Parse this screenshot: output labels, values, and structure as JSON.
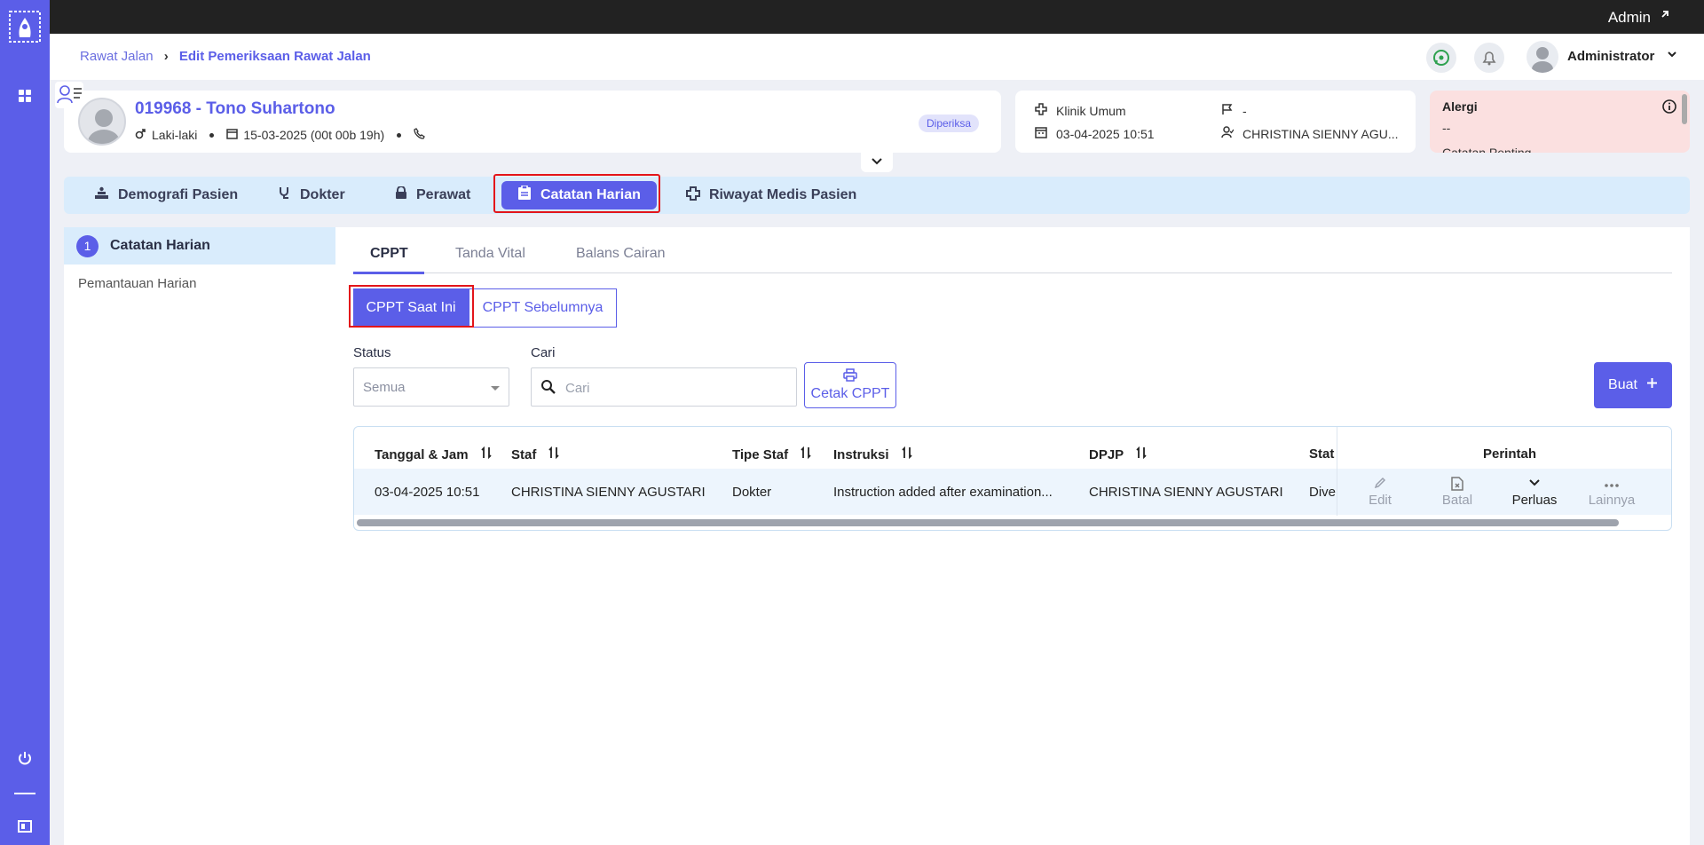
{
  "topbar": {
    "admin_label": "Admin"
  },
  "header": {
    "breadcrumb": {
      "parent": "Rawat Jalan",
      "current": "Edit Pemeriksaan Rawat Jalan"
    },
    "user_name": "Administrator"
  },
  "patient": {
    "name": "019968 - Tono Suhartono",
    "gender": "Laki-laki",
    "birth": "15-03-2025 (00t 00b 19h)",
    "status_badge": "Diperiksa"
  },
  "visit": {
    "clinic": "Klinik Umum",
    "datetime": "03-04-2025 10:51",
    "flag_value": "-",
    "doctor": "CHRISTINA SIENNY AGU..."
  },
  "allergy": {
    "title": "Alergi",
    "value": "--",
    "more": "Catatan Penting"
  },
  "main_tabs": [
    {
      "label": "Demografi Pasien"
    },
    {
      "label": "Dokter"
    },
    {
      "label": "Perawat"
    },
    {
      "label": "Catatan Harian"
    },
    {
      "label": "Riwayat Medis Pasien"
    }
  ],
  "steps": {
    "active_num": "1",
    "active_label": "Catatan Harian",
    "second": "Pemantauan Harian"
  },
  "sub_tabs": [
    {
      "label": "CPPT"
    },
    {
      "label": "Tanda Vital"
    },
    {
      "label": "Balans Cairan"
    }
  ],
  "toggles": {
    "current": "CPPT Saat Ini",
    "previous": "CPPT Sebelumnya"
  },
  "filters": {
    "status_label": "Status",
    "status_value": "Semua",
    "search_label": "Cari",
    "search_placeholder": "Cari",
    "print_label": "Cetak CPPT",
    "create_label": "Buat"
  },
  "table": {
    "headers": [
      "Tanggal & Jam",
      "Staf",
      "Tipe Staf",
      "Instruksi",
      "DPJP",
      "Stat"
    ],
    "actions_header": "Perintah",
    "rows": [
      {
        "datetime": "03-04-2025 10:51",
        "staff": "CHRISTINA SIENNY AGUSTARI",
        "staff_type": "Dokter",
        "instruction": "Instruction added after examination...",
        "dpjp": "CHRISTINA SIENNY AGUSTARI",
        "status": "Dive"
      }
    ],
    "actions": [
      {
        "label": "Edit",
        "enabled": false
      },
      {
        "label": "Batal",
        "enabled": false
      },
      {
        "label": "Perluas",
        "enabled": true
      },
      {
        "label": "Lainnya",
        "enabled": false
      }
    ]
  },
  "colors": {
    "primary": "#5b5ee8",
    "highlight": "#e3151a",
    "allergy_bg": "#fbe0e0",
    "tabs_bg": "#d9ecfc"
  }
}
